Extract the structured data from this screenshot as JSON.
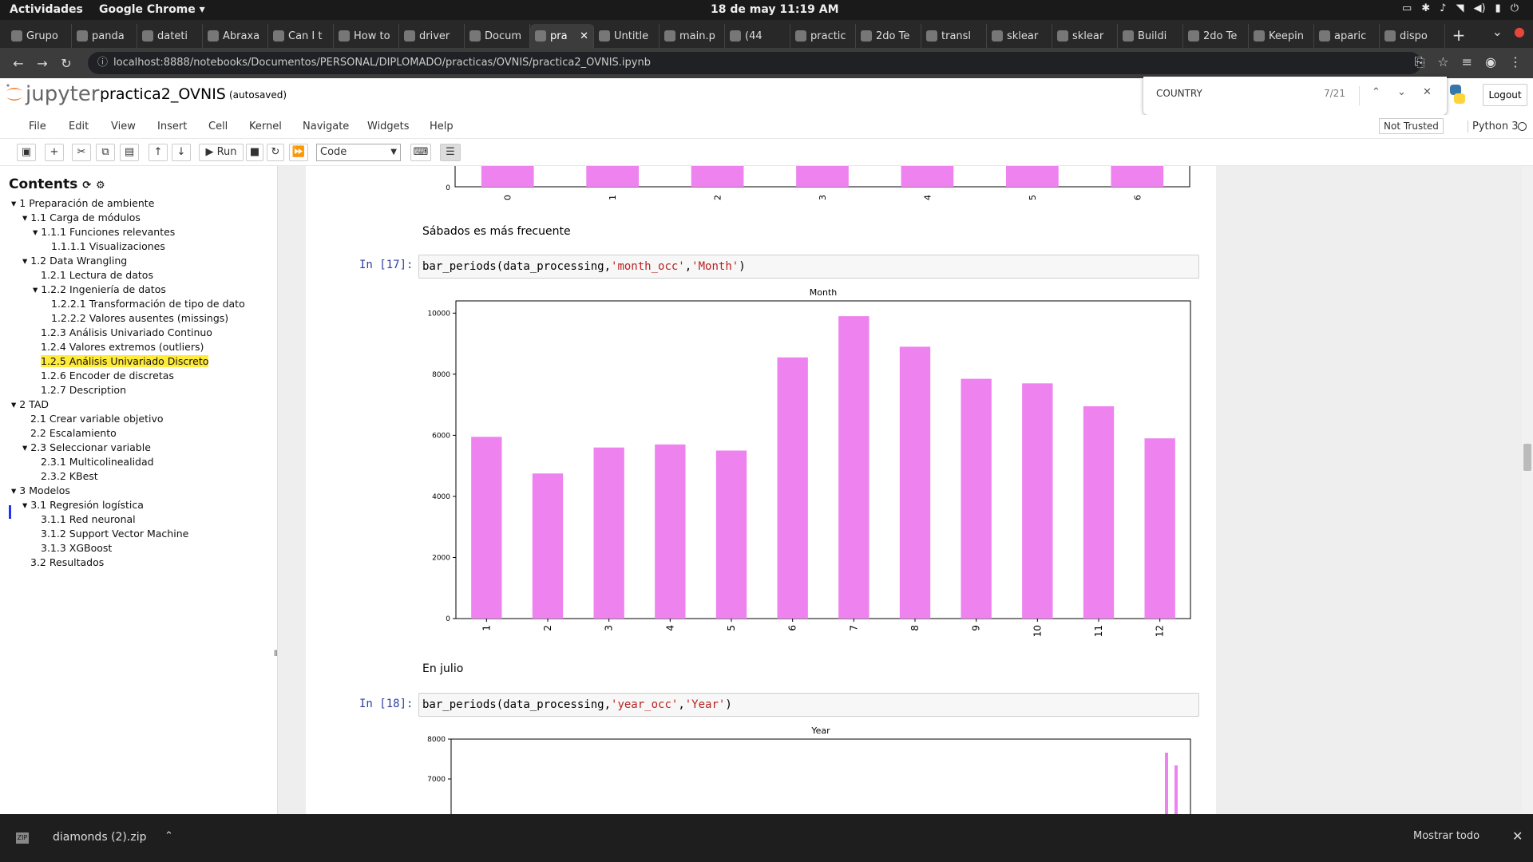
{
  "system_bar": {
    "activities": "Actividades",
    "app": "Google Chrome ▾",
    "clock": "18 de may  11:19 AM"
  },
  "tabs": [
    "Grupo",
    "panda",
    "dateti",
    "Abraxa",
    "Can I t",
    "How to",
    "driver",
    "Docum",
    "pra",
    "Untitle",
    "main.p",
    "(44",
    "practic",
    "2do Te",
    "transl",
    "sklear",
    "sklear",
    "Buildi",
    "2do Te",
    "Keepin",
    "aparic",
    "dispo"
  ],
  "active_tab_index": 8,
  "url": "localhost:8888/notebooks/Documentos/PERSONAL/DIPLOMADO/practicas/OVNIS/practica2_OVNIS.ipynb",
  "jupyter": {
    "logo_text": "jupyter",
    "notebook_name": "practica2_OVNIS",
    "autosave": "(autosaved)",
    "logout": "Logout",
    "trusted": "Not Trusted",
    "kernel": "Python 3"
  },
  "find": {
    "query": "COUNTRY",
    "count": "7/21"
  },
  "menu": [
    "File",
    "Edit",
    "View",
    "Insert",
    "Cell",
    "Kernel",
    "Navigate",
    "Widgets",
    "Help"
  ],
  "toolbar": {
    "run": "Run",
    "cell_type": "Code"
  },
  "toc": {
    "title": "Contents",
    "items": [
      {
        "num": "1",
        "label": "Preparación de ambiente"
      },
      {
        "num": "1.1",
        "label": "Carga de módulos"
      },
      {
        "num": "1.1.1",
        "label": "Funciones relevantes"
      },
      {
        "num": "1.1.1.1",
        "label": "Visualizaciones"
      },
      {
        "num": "1.2",
        "label": "Data Wrangling"
      },
      {
        "num": "1.2.1",
        "label": "Lectura de datos"
      },
      {
        "num": "1.2.2",
        "label": "Ingeniería de datos"
      },
      {
        "num": "1.2.2.1",
        "label": "Transformación de tipo de dato"
      },
      {
        "num": "1.2.2.2",
        "label": "Valores ausentes (missings)"
      },
      {
        "num": "1.2.3",
        "label": "Análisis Univariado Continuo"
      },
      {
        "num": "1.2.4",
        "label": "Valores extremos (outliers)"
      },
      {
        "num": "1.2.5",
        "label": "Análisis Univariado Discreto"
      },
      {
        "num": "1.2.6",
        "label": "Encoder de discretas"
      },
      {
        "num": "1.2.7",
        "label": "Description"
      },
      {
        "num": "2",
        "label": "TAD"
      },
      {
        "num": "2.1",
        "label": "Crear variable objetivo"
      },
      {
        "num": "2.2",
        "label": "Escalamiento"
      },
      {
        "num": "2.3",
        "label": "Seleccionar variable"
      },
      {
        "num": "2.3.1",
        "label": "Multicolinealidad"
      },
      {
        "num": "2.3.2",
        "label": "KBest"
      },
      {
        "num": "3",
        "label": "Modelos"
      },
      {
        "num": "3.1",
        "label": "Regresión logística"
      },
      {
        "num": "3.1.1",
        "label": "Red neuronal"
      },
      {
        "num": "3.1.2",
        "label": "Support Vector Machine"
      },
      {
        "num": "3.1.3",
        "label": "XGBoost"
      },
      {
        "num": "3.2",
        "label": "Resultados"
      }
    ]
  },
  "notebook": {
    "md1": "Sábados es más frecuente",
    "cell17": {
      "prompt": "In [17]:",
      "code_fn": "bar_periods(data_processing,",
      "code_a1": "'month_occ'",
      "code_comma": ",",
      "code_a2": "'Month'",
      "code_end": ")"
    },
    "md2": "En julio",
    "cell18": {
      "prompt": "In [18]:",
      "code_fn": "bar_periods(data_processing,",
      "code_a1": "'year_occ'",
      "code_comma": ",",
      "code_a2": "'Year'",
      "code_end": ")"
    }
  },
  "chart_data": [
    {
      "type": "bar",
      "title": "",
      "categories": [
        "0",
        "1",
        "2",
        "3",
        "4",
        "5",
        "6"
      ],
      "yticks": [
        "0"
      ],
      "color": "#ee82ee",
      "note_visible": "partial (cropped top)"
    },
    {
      "type": "bar",
      "title": "Month",
      "categories": [
        "1",
        "2",
        "3",
        "4",
        "5",
        "6",
        "7",
        "8",
        "9",
        "10",
        "11",
        "12"
      ],
      "values": [
        5950,
        4750,
        5600,
        5700,
        5500,
        8550,
        9900,
        8900,
        7850,
        7700,
        6950,
        5900
      ],
      "yticks": [
        "0",
        "2000",
        "4000",
        "6000",
        "8000",
        "10000"
      ],
      "ylim": [
        0,
        10400
      ],
      "color": "#ee82ee"
    },
    {
      "type": "bar",
      "title": "Year",
      "yticks": [
        "7000",
        "8000"
      ],
      "color": "#ee82ee",
      "note_visible": "partial (cropped bottom)"
    }
  ],
  "download": {
    "file": "diamonds (2).zip",
    "icon_text": "ZIP",
    "show_all": "Mostrar todo"
  }
}
